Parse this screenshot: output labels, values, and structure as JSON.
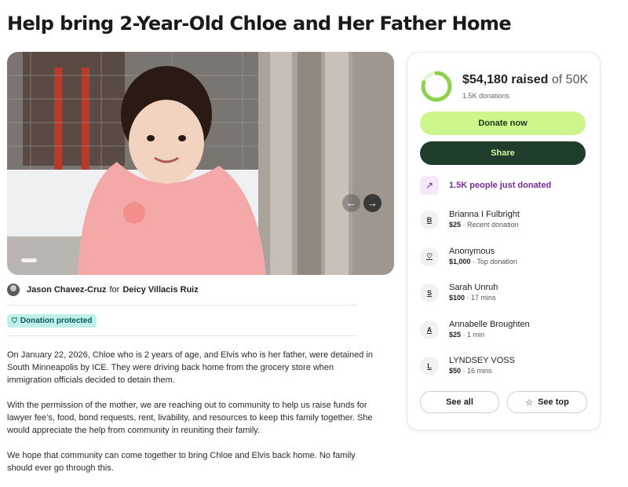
{
  "page_title": "Help bring 2-Year-Old Chloe and Her Father Home",
  "gallery": {
    "prev_icon": "←",
    "next_icon": "→"
  },
  "organizer": {
    "name": "Jason Chavez-Cruz",
    "connector": "for",
    "beneficiary": "Deicy Villacis Ruiz"
  },
  "badge": {
    "icon": "shield-icon",
    "label": "Donation protected"
  },
  "story": {
    "paragraphs": [
      "On January 22, 2026, Chloe who is 2 years of age, and Elvis who is her father, were detained in South Minneapolis by ICE. They were driving back home from the grocery store when immigration officials decided to detain them.",
      "With the permission of the mother, we are reaching out to community to help us raise funds for lawyer fee’s, food, bond requests, rent, livability, and resources to keep this family together. She would appreciate the help from community in reuniting their family.",
      "We hope that community can come together to bring Chloe and Elvis back home. No family should ever go through this."
    ]
  },
  "fundraiser": {
    "progress_fraction": 0.8,
    "raised_amount": "$54,180 raised",
    "goal_text": "of 50K",
    "donation_count": "1.5K donations",
    "donate_label": "Donate now",
    "share_label": "Share",
    "trend_icon": "trending-up-icon",
    "trend_text": "1.5K people just donated",
    "colors": {
      "ring": "#8fd14f",
      "donate": "#cdf58c",
      "share": "#1e3d2a",
      "trend": "#7a2a9a"
    }
  },
  "donations": [
    {
      "initial": "B",
      "name": "Brianna I Fulbright",
      "amount": "$25",
      "detail": " · Recent donation"
    },
    {
      "initial": "",
      "name": "Anonymous",
      "amount": "$1,000",
      "detail": " · Top donation"
    },
    {
      "initial": "S",
      "name": "Sarah Unruh",
      "amount": "$100",
      "detail": " · 17 mins"
    },
    {
      "initial": "A",
      "name": "Annabelle Broughten",
      "amount": "$25",
      "detail": " · 1 min"
    },
    {
      "initial": "L",
      "name": "LYNDSEY VOSS",
      "amount": "$50",
      "detail": " · 16 mins"
    }
  ],
  "see_all_label": "See all",
  "see_top_label": "See top",
  "see_top_icon": "☆"
}
